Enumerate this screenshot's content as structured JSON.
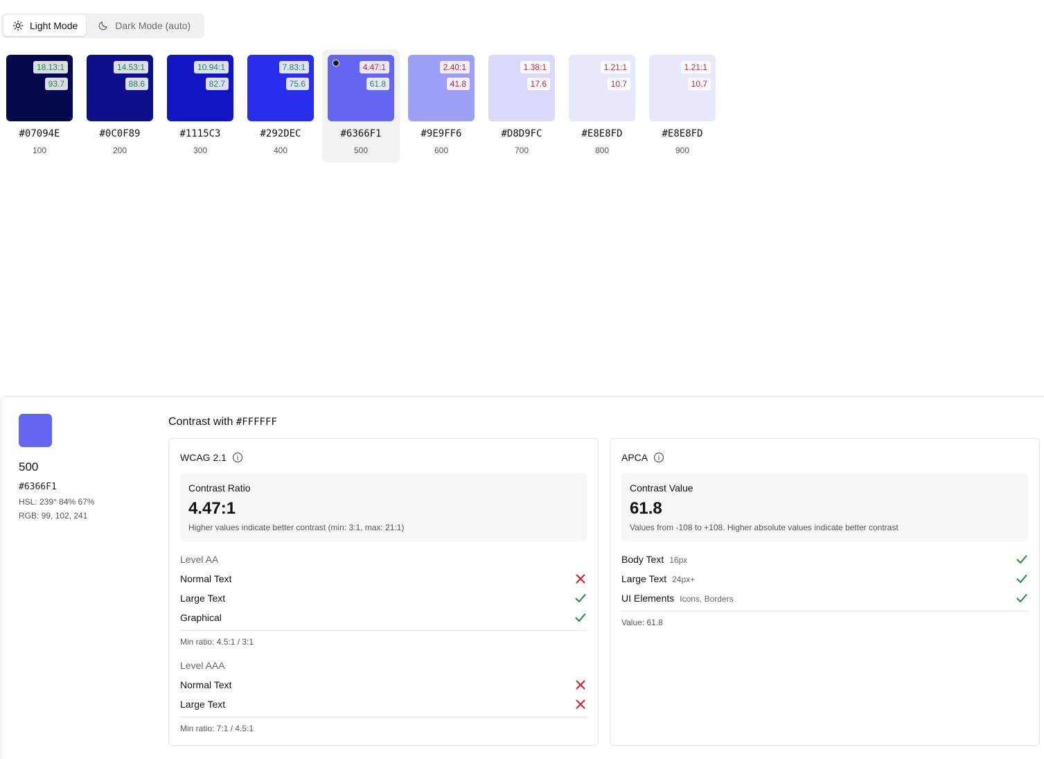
{
  "mode_toggle": {
    "light_label": "Light Mode",
    "dark_label": "Dark Mode (auto)",
    "active": "light"
  },
  "colors": {
    "pass": "#1f8a3a",
    "fail": "#d0202a"
  },
  "swatches": [
    {
      "hex": "#07094E",
      "step": "100",
      "ratio": "18.13:1",
      "ratio_pass": true,
      "apca": "93.7",
      "apca_pass": true,
      "selected": false
    },
    {
      "hex": "#0C0F89",
      "step": "200",
      "ratio": "14.53:1",
      "ratio_pass": true,
      "apca": "88.6",
      "apca_pass": true,
      "selected": false
    },
    {
      "hex": "#1115C3",
      "step": "300",
      "ratio": "10.94:1",
      "ratio_pass": true,
      "apca": "82.7",
      "apca_pass": true,
      "selected": false
    },
    {
      "hex": "#292DEC",
      "step": "400",
      "ratio": "7.83:1",
      "ratio_pass": true,
      "apca": "75.6",
      "apca_pass": true,
      "selected": false
    },
    {
      "hex": "#6366F1",
      "step": "500",
      "ratio": "4.47:1",
      "ratio_pass": false,
      "apca": "61.8",
      "apca_pass": true,
      "selected": true
    },
    {
      "hex": "#9E9FF6",
      "step": "600",
      "ratio": "2.40:1",
      "ratio_pass": false,
      "apca": "41.8",
      "apca_pass": false,
      "selected": false
    },
    {
      "hex": "#D8D9FC",
      "step": "700",
      "ratio": "1.38:1",
      "ratio_pass": false,
      "apca": "17.6",
      "apca_pass": false,
      "selected": false
    },
    {
      "hex": "#E8E8FD",
      "step": "800",
      "ratio": "1.21:1",
      "ratio_pass": false,
      "apca": "10.7",
      "apca_pass": false,
      "selected": false
    },
    {
      "hex": "#E8E8FD",
      "step": "900",
      "ratio": "1.21:1",
      "ratio_pass": false,
      "apca": "10.7",
      "apca_pass": false,
      "selected": false
    }
  ],
  "detail": {
    "color": "#6366F1",
    "step": "500",
    "hex": "#6366F1",
    "hsl": "HSL: 239° 84% 67%",
    "rgb": "RGB: 99, 102, 241",
    "contrast_prefix": "Contrast with",
    "contrast_against": "#FFFFFF",
    "wcag": {
      "title": "WCAG 2.1",
      "stat_label": "Contrast Ratio",
      "stat_value": "4.47:1",
      "stat_desc": "Higher values indicate better contrast (min: 3:1, max: 21:1)",
      "aa_title": "Level AA",
      "aa_rows": [
        {
          "label": "Normal Text",
          "pass": false
        },
        {
          "label": "Large Text",
          "pass": true
        },
        {
          "label": "Graphical",
          "pass": true
        }
      ],
      "aa_foot": "Min ratio: 4.5:1 / 3:1",
      "aaa_title": "Level AAA",
      "aaa_rows": [
        {
          "label": "Normal Text",
          "pass": false
        },
        {
          "label": "Large Text",
          "pass": false
        }
      ],
      "aaa_foot": "Min ratio: 7:1 / 4.5:1"
    },
    "apca": {
      "title": "APCA",
      "stat_label": "Contrast Value",
      "stat_value": "61.8",
      "stat_desc": "Values from -108 to +108. Higher absolute values indicate better contrast",
      "rows": [
        {
          "label": "Body Text",
          "sub": "16px",
          "pass": true
        },
        {
          "label": "Large Text",
          "sub": "24px+",
          "pass": true
        },
        {
          "label": "UI Elements",
          "sub": "Icons, Borders",
          "pass": true
        }
      ],
      "foot": "Value: 61.8"
    }
  }
}
